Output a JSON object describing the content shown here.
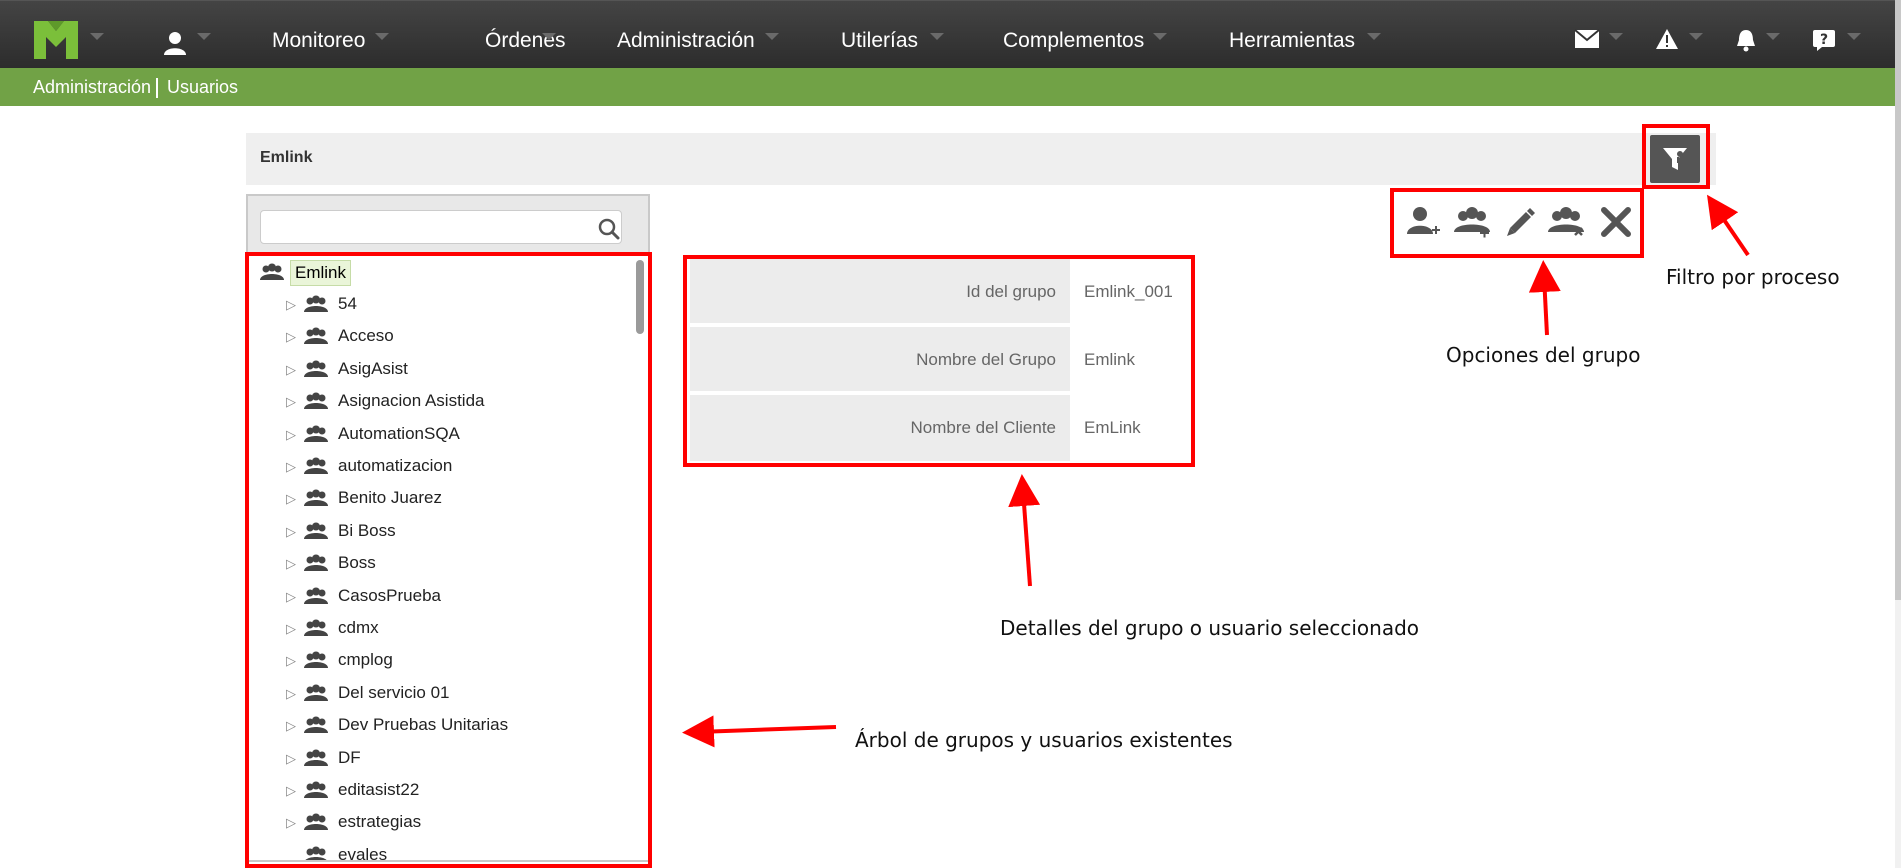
{
  "nav": {
    "items": [
      "Monitoreo",
      "Órdenes",
      "Administración",
      "Utilerías",
      "Complementos",
      "Herramientas"
    ]
  },
  "breadcrumb": [
    "Administración",
    "Usuarios"
  ],
  "header": {
    "title": "Emlink"
  },
  "search": {
    "placeholder": ""
  },
  "tree": {
    "root": "Emlink",
    "children": [
      "54",
      "Acceso",
      "AsigAsist",
      "Asignacion Asistida",
      "AutomationSQA",
      "automatizacion",
      "Benito Juarez",
      "Bi Boss",
      "Boss",
      "CasosPrueba",
      "cdmx",
      "cmplog",
      "Del servicio 01",
      "Dev Pruebas Unitarias",
      "DF",
      "editasist22",
      "estrategias",
      "evales"
    ]
  },
  "details": [
    {
      "label": "Id del grupo",
      "value": "Emlink_001"
    },
    {
      "label": "Nombre del Grupo",
      "value": "Emlink"
    },
    {
      "label": "Nombre del Cliente",
      "value": "EmLink"
    }
  ],
  "annotations": {
    "filter": "Filtro por proceso",
    "options": "Opciones del grupo",
    "details": "Detalles del grupo o usuario seleccionado",
    "tree": "Árbol de grupos y usuarios existentes"
  },
  "colors": {
    "topbar": "#333333",
    "breadcrumb": "#71a246",
    "highlight": "#ff0000",
    "logo_green": "#7bbf3a"
  },
  "icons": {
    "nav_right": [
      "mail-icon",
      "warning-icon",
      "bell-icon",
      "help-icon"
    ],
    "group_options": [
      "add-user-icon",
      "add-group-icon",
      "edit-icon",
      "remove-group-icon",
      "delete-icon"
    ]
  }
}
